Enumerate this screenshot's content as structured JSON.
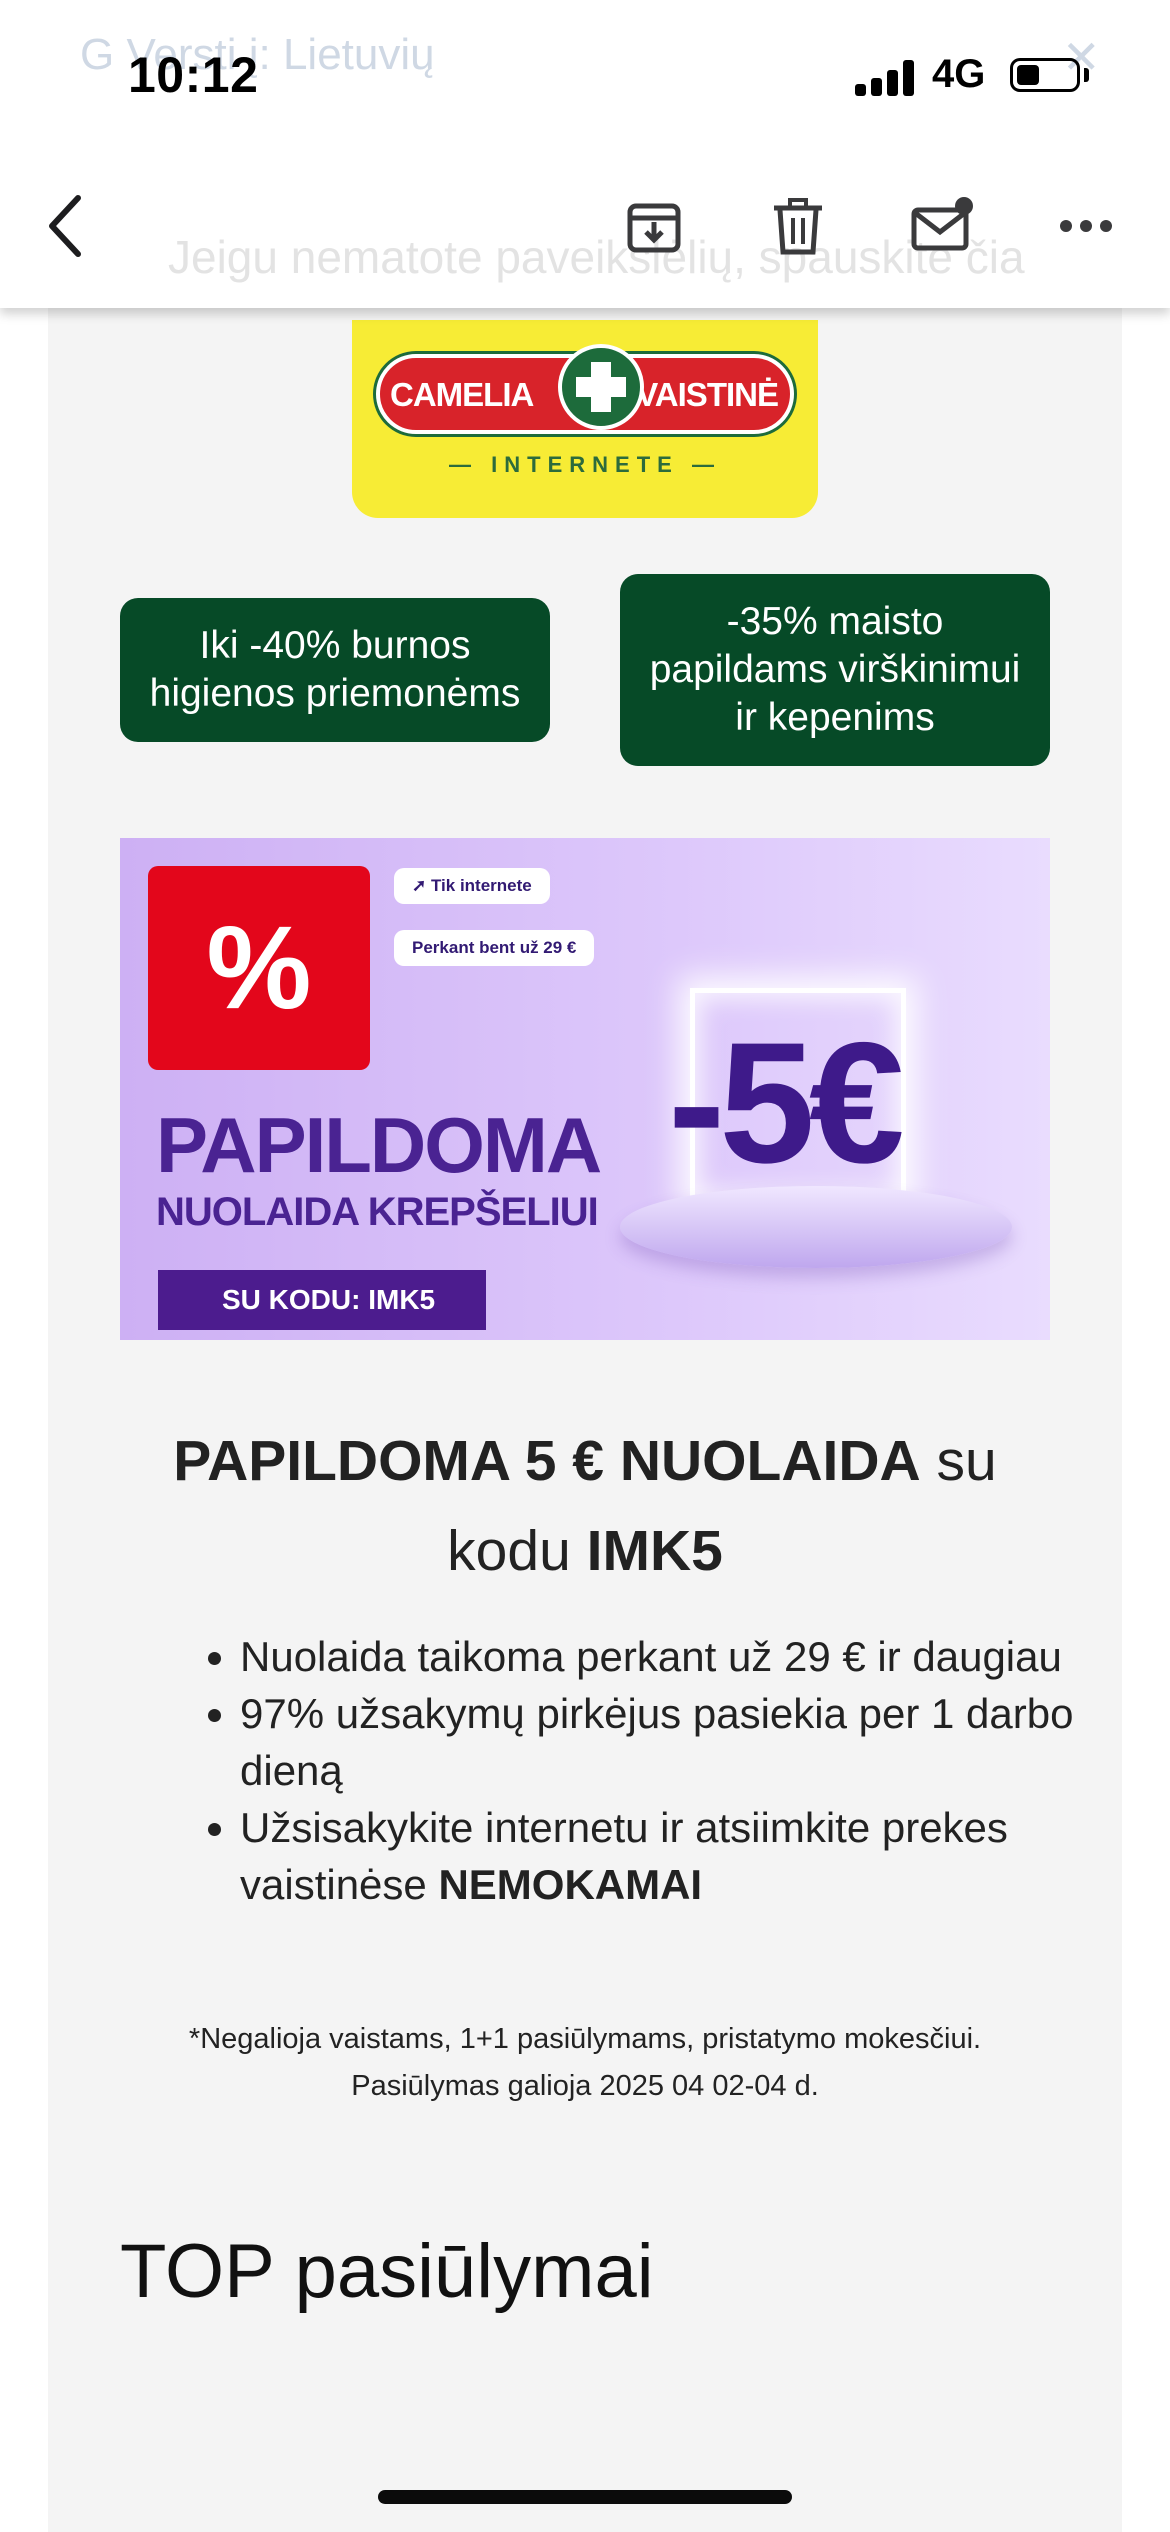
{
  "status_bar": {
    "time": "10:12",
    "network": "4G",
    "battery_level": 0.4,
    "ghost_banner_text": "G Versti į: Lietuvių"
  },
  "toolbar": {
    "ghost_text": "Jeigu nematote paveikslėlių, spauskite čia",
    "icons": [
      "back-icon",
      "archive-icon",
      "trash-icon",
      "mark-unread-icon",
      "more-icon"
    ]
  },
  "email": {
    "logo": {
      "left_text": "CAMELIA",
      "right_text": "VAISTINĖ",
      "sub_text": "— INTERNETE —"
    },
    "promo_buttons": [
      {
        "label_line1": "Iki -40% burnos",
        "label_line2": "higienos priemonėms"
      },
      {
        "label_line1": "-35% maisto",
        "label_line2": "papildams virškinimui",
        "label_line3": "ir kepenims"
      }
    ],
    "banner": {
      "percent_symbol": "%",
      "pill_online": "Tik internete",
      "pill_minimum": "Perkant bent už 29 €",
      "big_text": "PAPILDOMA",
      "sub_text": "NUOLAIDA KREPŠELIUI",
      "code_text": "SU KODU: IMK5",
      "price_text": "-5€"
    },
    "headline": {
      "bold_part": "PAPILDOMA 5 € NUOLAIDA",
      "normal_part": " su kodu ",
      "code": "IMK5"
    },
    "bullets": [
      {
        "text": "Nuolaida taikoma perkant už 29 € ir daugiau"
      },
      {
        "text": "97% užsakymų pirkėjus pasiekia per 1 darbo dieną"
      },
      {
        "text_before": "Užsisakykite internetu ir atsiimkite prekes vaistinėse ",
        "bold": "NEMOKAMAI"
      }
    ],
    "note_line1": "*Negalioja vaistams, 1+1 pasiūlymams, pristatymo mokesčiui.",
    "note_line2": "Pasiūlymas galioja 2025 04 02-04 d.",
    "section_title": "TOP pasiūlymai"
  },
  "colors": {
    "brand_green": "#064a27",
    "logo_yellow": "#f7ec35",
    "logo_red": "#d8232a",
    "banner_purple": "#4a2392",
    "banner_red": "#e3061b"
  }
}
